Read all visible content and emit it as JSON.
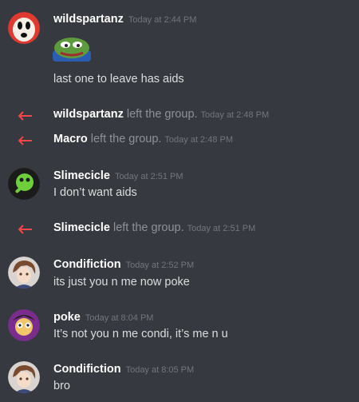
{
  "messages": [
    {
      "username": "wildspartanz",
      "timestamp": "Today at 2:44 PM",
      "emoji": "pepe-frog-emoji",
      "text": "last one to leave has aids"
    },
    {
      "system": true,
      "username": "wildspartanz",
      "action": "left the group.",
      "timestamp": "Today at 2:48 PM"
    },
    {
      "system": true,
      "username": "Macro",
      "action": "left the group.",
      "timestamp": "Today at 2:48 PM"
    },
    {
      "username": "Slimecicle",
      "timestamp": "Today at 2:51 PM",
      "text": "I don’t want aids"
    },
    {
      "system": true,
      "username": "Slimecicle",
      "action": "left the group.",
      "timestamp": "Today at 2:51 PM"
    },
    {
      "username": "Condifiction",
      "timestamp": "Today at 2:52 PM",
      "text": "its just you n me now poke"
    },
    {
      "username": "poke",
      "timestamp": "Today at 8:04 PM",
      "text": "It’s not you n me condi, it’s me n u"
    },
    {
      "username": "Condifiction",
      "timestamp": "Today at 8:05 PM",
      "text": "bro"
    }
  ],
  "colors": {
    "background": "#36393f",
    "username": "#ffffff",
    "timestamp": "#72767d",
    "text": "#dcddde",
    "system_text": "#8e9297",
    "leave_arrow": "#f04747"
  }
}
